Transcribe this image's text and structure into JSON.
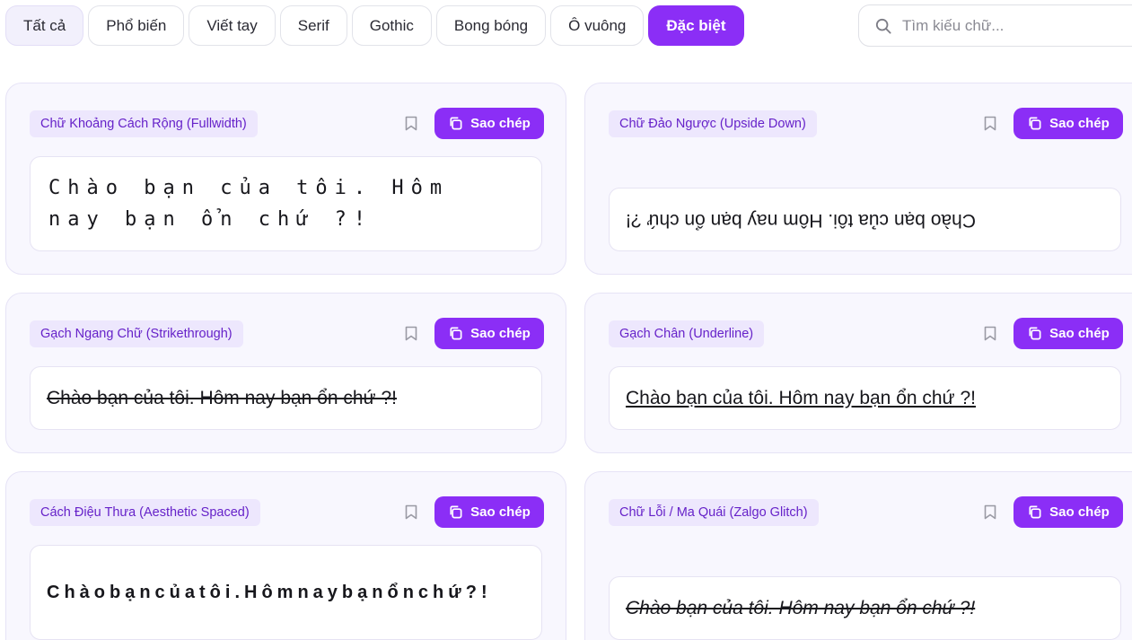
{
  "tabs": [
    {
      "label": "Tất cả"
    },
    {
      "label": "Phổ biến"
    },
    {
      "label": "Viết tay"
    },
    {
      "label": "Serif"
    },
    {
      "label": "Gothic"
    },
    {
      "label": "Bong bóng"
    },
    {
      "label": "Ô vuông"
    },
    {
      "label": "Đặc biệt"
    }
  ],
  "search": {
    "placeholder": "Tìm kiếu chữ..."
  },
  "copy_label": "Sao chép",
  "cards": [
    {
      "title": "Chữ Khoảng Cách Rộng (Fullwidth)",
      "output": "Chào bạn của tôi. Hôm nay bạn ổn chứ ?!"
    },
    {
      "title": "Chữ Đảo Ngược (Upside Down)",
      "output": "Chào bạn của tôi. Hôm nay bạn ổn chứ ?!"
    },
    {
      "title": "Gạch Ngang Chữ (Strikethrough)",
      "output": "Chào bạn của tôi. Hôm nay bạn ổn chứ ?!"
    },
    {
      "title": "Gạch Chân (Underline)",
      "output": "Chào bạn của tôi. Hôm nay bạn ổn chứ ?!"
    },
    {
      "title": "Cách Điệu Thưa (Aesthetic Spaced)",
      "output": "Chàobạncủatôi.Hômnaybạnổnchứ?!"
    },
    {
      "title": "Chữ Lỗi / Ma Quái (Zalgo Glitch)",
      "output": "Chào bạn của tôi. Hôm nay bạn ổn chứ ?!"
    }
  ]
}
